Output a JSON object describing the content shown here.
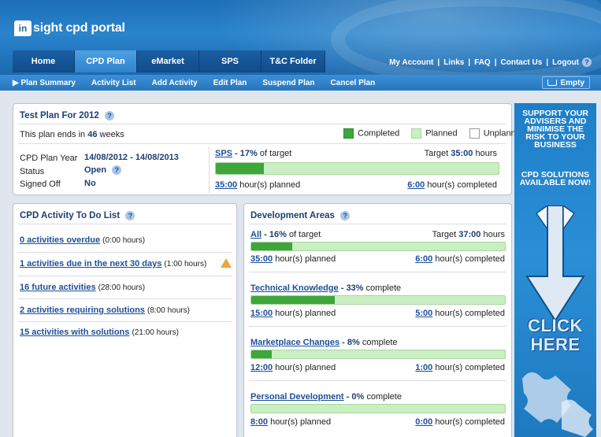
{
  "header": {
    "logo_mark": "in",
    "logo_text": "sight cpd portal",
    "tabs": [
      "Home",
      "CPD Plan",
      "eMarket",
      "SPS",
      "T&C Folder"
    ],
    "links": [
      "My Account",
      "Links",
      "FAQ",
      "Contact Us",
      "Logout"
    ],
    "sep": "|",
    "help": "?"
  },
  "subnav": {
    "items": [
      "▶ Plan Summary",
      "Activity List",
      "Add Activity",
      "Edit Plan",
      "Suspend Plan",
      "Cancel Plan"
    ],
    "empty_label": "Empty"
  },
  "plan": {
    "title": "Test Plan For 2012",
    "ends_prefix": "This plan ends in",
    "ends_weeks": "46",
    "ends_suffix": "weeks",
    "legend": [
      "Completed",
      "Planned",
      "Unplanned"
    ],
    "year_label": "CPD Plan Year",
    "year_value": "14/08/2012 - 14/08/2013",
    "status_label": "Status",
    "status_value": "Open",
    "signed_label": "Signed Off",
    "signed_value": "No",
    "sps_link": "SPS",
    "sps_pct": "- 17%",
    "sps_of": "of target",
    "target_label": "Target",
    "target_value": "35:00",
    "target_unit": "hours",
    "sps_progress": 0.17,
    "planned_value": "35:00",
    "planned_label": "hour(s) planned",
    "completed_value": "6:00",
    "completed_label": "hour(s) completed"
  },
  "todo": {
    "title": "CPD Activity To Do List",
    "items": [
      {
        "link": "0 activities overdue",
        "note": "(0:00 hours)"
      },
      {
        "link": "1 activities due in the next 30 days",
        "note": "(1:00 hours)"
      },
      {
        "link": "16 future activities",
        "note": "(28:00 hours)"
      },
      {
        "link": "2 activities requiring solutions",
        "note": "(8:00 hours)"
      },
      {
        "link": "15 activities with solutions",
        "note": "(21:00 hours)"
      }
    ]
  },
  "dev": {
    "title": "Development Areas",
    "all_link": "All",
    "all_pct": "- 16%",
    "all_of": "of target",
    "target_label": "Target",
    "target_value": "37:00",
    "target_unit": "hours",
    "all_progress": 0.16,
    "all_planned": "35:00",
    "all_completed": "6:00",
    "planned_label": "hour(s) planned",
    "completed_label": "hour(s) completed",
    "complete_word": "complete",
    "areas": [
      {
        "name": "Technical Knowledge",
        "pct": "- 33%",
        "progress": 0.33,
        "planned": "15:00",
        "completed": "5:00"
      },
      {
        "name": "Marketplace Changes",
        "pct": "- 8%",
        "progress": 0.08,
        "planned": "12:00",
        "completed": "1:00"
      },
      {
        "name": "Personal Development",
        "pct": "- 0%",
        "progress": 0.0,
        "planned": "8:00",
        "completed": "0:00"
      }
    ]
  },
  "ad": {
    "line1": "Support your advisers and minimise the risk to your business",
    "line2": "CPD solutions available now!",
    "click1": "CLICK",
    "click2": "HERE"
  },
  "colors": {
    "completed": "#3ea63a",
    "planned": "#c9efc2",
    "brand": "#1d6ab0"
  }
}
